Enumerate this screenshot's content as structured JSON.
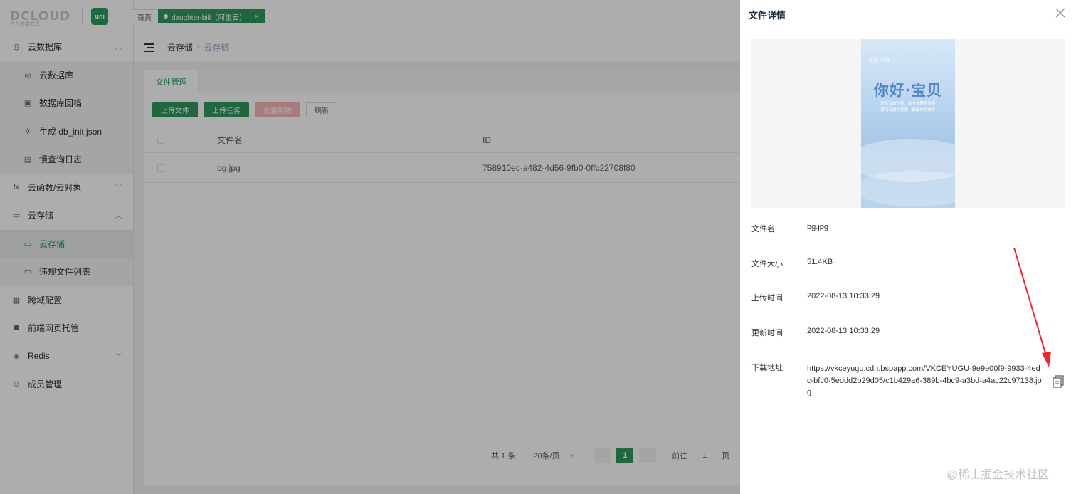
{
  "logo": {
    "text": "DCLOUD",
    "sub": "为开发者而生",
    "badge": "uni"
  },
  "tags": {
    "home": "首页",
    "active": "daughter-bill（阿里云）",
    "close": "×"
  },
  "sidebar": {
    "items": [
      {
        "label": "云数据库",
        "icon": "cloud-db-icon",
        "glyph": "◎",
        "chevron": "︿"
      },
      {
        "label": "云数据库",
        "icon": "cloud-db-icon",
        "glyph": "◎"
      },
      {
        "label": "数据库回档",
        "icon": "db-rollback-icon",
        "glyph": "▣"
      },
      {
        "label": "生成 db_init.json",
        "icon": "generate-icon",
        "glyph": "✲"
      },
      {
        "label": "慢查询日志",
        "icon": "log-icon",
        "glyph": "▤"
      },
      {
        "label": "云函数/云对象",
        "icon": "function-icon",
        "glyph": "fx",
        "chevron": "﹀"
      },
      {
        "label": "云存储",
        "icon": "storage-icon",
        "glyph": "▭",
        "chevron": "︿"
      },
      {
        "label": "云存储",
        "icon": "storage-icon",
        "glyph": "▭"
      },
      {
        "label": "违规文件列表",
        "icon": "violation-list-icon",
        "glyph": "▭"
      },
      {
        "label": "跨域配置",
        "icon": "cors-icon",
        "glyph": "▦"
      },
      {
        "label": "前端网页托管",
        "icon": "hosting-icon",
        "glyph": "☗"
      },
      {
        "label": "Redis",
        "icon": "redis-icon",
        "glyph": "◈",
        "chevron": "﹀"
      },
      {
        "label": "成员管理",
        "icon": "members-icon",
        "glyph": "☺"
      }
    ]
  },
  "breadcrumb": {
    "parent": "云存储",
    "sep": "/",
    "current": "云存储"
  },
  "main": {
    "tab": "文件管理",
    "buttons": {
      "upload_file": "上传文件",
      "upload_task": "上传任务",
      "batch_delete": "批量删除",
      "refresh": "刷新"
    },
    "table": {
      "headers": {
        "name": "文件名",
        "id": "ID"
      },
      "rows": [
        {
          "name": "bg.jpg",
          "id": "758910ec-a482-4d56-9fb0-0ffc22708f80"
        }
      ]
    },
    "pagination": {
      "total": "共 1 条",
      "page_size": "20条/页",
      "page": "1",
      "goto_label": "前往",
      "goto_value": "1",
      "goto_unit": "页",
      "prev": "‹",
      "next": "›"
    }
  },
  "drawer": {
    "title": "文件详情",
    "poster": {
      "brand": "宝宝·小日",
      "title": "你好·宝贝",
      "sub1": "愿所有的开始，都令你期待欢喜",
      "sub2": "愿所有爱的相遇，都是你的美好"
    },
    "fields": {
      "name_label": "文件名",
      "name_value": "bg.jpg",
      "size_label": "文件大小",
      "size_value": "51.4KB",
      "upload_label": "上传时间",
      "upload_value": "2022-08-13 10:33:29",
      "update_label": "更新时间",
      "update_value": "2022-08-13 10:33:29",
      "url_label": "下载地址",
      "url_value": "https://vkceyugu.cdn.bspapp.com/VKCEYUGU-9e9e00f9-9933-4edc-bfc0-5eddd2b29d05/c1b429a6-389b-4bc9-a3bd-a4ac22c97138.jpg"
    }
  },
  "watermark": "@稀土掘金技术社区",
  "colors": {
    "primary": "#2e9a5e",
    "danger_disabled": "#f9b4b4",
    "annotation_arrow": "#f5222d"
  }
}
